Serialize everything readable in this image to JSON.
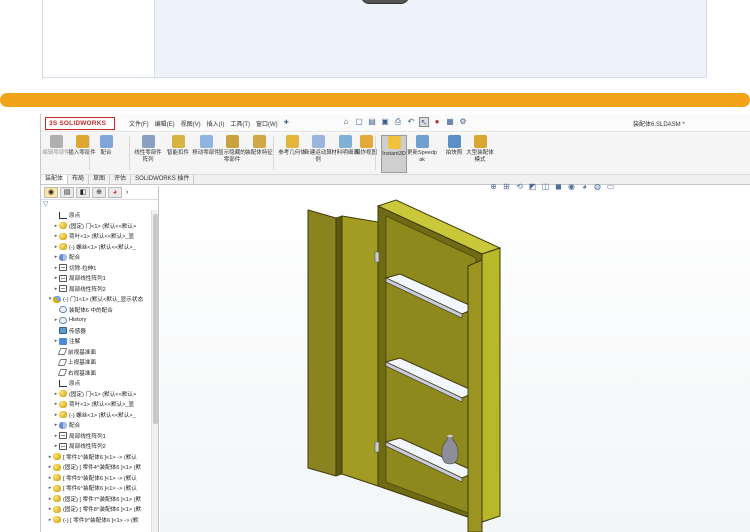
{
  "app": {
    "logo_text": "3S SOLIDWORKS",
    "menus": [
      "文件(F)",
      "编辑(E)",
      "视图(V)",
      "插入(I)",
      "工具(T)",
      "窗口(W)"
    ],
    "document_title": "装配体6.SLDASM *",
    "quick_access_icons": [
      "home-icon",
      "new-icon",
      "open-icon",
      "save-icon",
      "print-icon",
      "undo-icon",
      "select-icon",
      "traffic-light-icon",
      "file-props-icon",
      "options-icon"
    ]
  },
  "ribbon": {
    "buttons": [
      {
        "label": "编辑零部件",
        "icon": "edit-component-icon",
        "dim": true
      },
      {
        "label": "插入零部件",
        "icon": "insert-component-icon",
        "dim": false
      },
      {
        "label": "配合",
        "icon": "mate-icon",
        "dim": false
      },
      {
        "label": "线性零部件阵列",
        "icon": "linear-pattern-icon",
        "dim": false
      },
      {
        "label": "智能扣件",
        "icon": "smart-fastener-icon",
        "dim": false
      },
      {
        "label": "移动零部件",
        "icon": "move-component-icon",
        "dim": false
      },
      {
        "label": "显示隐藏的零部件",
        "icon": "show-hidden-icon",
        "dim": false
      },
      {
        "label": "装配体特征",
        "icon": "assembly-feature-icon",
        "dim": false
      },
      {
        "label": "参考几何体",
        "icon": "reference-geometry-icon",
        "dim": false
      },
      {
        "label": "新建运动算例",
        "icon": "motion-study-icon",
        "dim": false
      },
      {
        "label": "材料明细表",
        "icon": "bom-icon",
        "dim": false
      },
      {
        "label": "爆炸视图",
        "icon": "exploded-view-icon",
        "dim": false
      },
      {
        "label": "Instant3D",
        "icon": "instant3d-icon",
        "dim": false,
        "active": true
      },
      {
        "label": "更新Speedpak",
        "icon": "speedpak-icon",
        "dim": false
      },
      {
        "label": "拍快照",
        "icon": "snapshot-icon",
        "dim": false
      },
      {
        "label": "大型装配体模式",
        "icon": "large-assembly-icon",
        "dim": false
      }
    ]
  },
  "tabs": [
    "装配体",
    "布局",
    "草图",
    "评估",
    "SOLIDWORKS 插件"
  ],
  "tree": {
    "rows": [
      {
        "arrow": "",
        "icon": "origin",
        "label": "原点",
        "indent": 1
      },
      {
        "arrow": "▸",
        "icon": "part",
        "label": "(固定) 门<1> (默认<<默认>",
        "indent": 1
      },
      {
        "arrow": "▸",
        "icon": "part",
        "label": "荷叶<1> (默认<<默认>_显",
        "indent": 1
      },
      {
        "arrow": "▸",
        "icon": "part",
        "label": "(-) 螺丝<1> (默认<<默认>_",
        "indent": 1
      },
      {
        "arrow": "▸",
        "icon": "mate",
        "label": "配合",
        "indent": 1
      },
      {
        "arrow": "▸",
        "icon": "feat",
        "label": "切除-拉伸1",
        "indent": 1
      },
      {
        "arrow": "▸",
        "icon": "feat",
        "label": "局部线性阵列1",
        "indent": 1
      },
      {
        "arrow": "▸",
        "icon": "feat",
        "label": "局部线性阵列2",
        "indent": 1
      },
      {
        "arrow": "▾",
        "icon": "sub",
        "label": "(-) 门1<1> (默认<默认_显示状态",
        "indent": 0
      },
      {
        "arrow": "",
        "icon": "hist",
        "label": "装配体6 中的配合",
        "indent": 1
      },
      {
        "arrow": "▸",
        "icon": "hist",
        "label": "History",
        "indent": 1
      },
      {
        "arrow": "",
        "icon": "sensor",
        "label": "传感器",
        "indent": 1
      },
      {
        "arrow": "▸",
        "icon": "note",
        "label": "注解",
        "indent": 1
      },
      {
        "arrow": "",
        "icon": "plane",
        "label": "前视基准面",
        "indent": 1
      },
      {
        "arrow": "",
        "icon": "plane",
        "label": "上视基准面",
        "indent": 1
      },
      {
        "arrow": "",
        "icon": "plane",
        "label": "右视基准面",
        "indent": 1
      },
      {
        "arrow": "",
        "icon": "origin",
        "label": "原点",
        "indent": 1
      },
      {
        "arrow": "▸",
        "icon": "part",
        "label": "(固定) 门<1> (默认<<默认>",
        "indent": 1
      },
      {
        "arrow": "▸",
        "icon": "part",
        "label": "荷叶<1> (默认<<默认>_显",
        "indent": 1
      },
      {
        "arrow": "▸",
        "icon": "part",
        "label": "(-) 螺丝<1> (默认<<默认>_",
        "indent": 1
      },
      {
        "arrow": "▸",
        "icon": "mate",
        "label": "配合",
        "indent": 1
      },
      {
        "arrow": "▸",
        "icon": "feat",
        "label": "局部线性阵列1",
        "indent": 1
      },
      {
        "arrow": "▸",
        "icon": "feat",
        "label": "局部线性阵列2",
        "indent": 1
      },
      {
        "arrow": "▸",
        "icon": "part",
        "label": "[ 零件1^装配体6 ]<1> -> (默认",
        "indent": 0
      },
      {
        "arrow": "▸",
        "icon": "part",
        "label": "(固定) [ 零件4^装配体6 ]<1> (默",
        "indent": 0
      },
      {
        "arrow": "▸",
        "icon": "part",
        "label": "[ 零件5^装配体6 ]<1> -> (默认",
        "indent": 0
      },
      {
        "arrow": "▸",
        "icon": "part",
        "label": "[ 零件6^装配体6 ]<1> -> (默认",
        "indent": 0
      },
      {
        "arrow": "▸",
        "icon": "part",
        "label": "(固定) [ 零件7^装配体6 ]<1> (默",
        "indent": 0
      },
      {
        "arrow": "▸",
        "icon": "part",
        "label": "(固定) [ 零件8^装配体6 ]<1> (默",
        "indent": 0
      },
      {
        "arrow": "▸",
        "icon": "part",
        "label": "(-) [ 零件9^装配体6 ]<1> -> (默",
        "indent": 0
      }
    ]
  },
  "colors": {
    "orange_bar": "#f3a318",
    "cabinet_body": "#b7b82a",
    "cabinet_dark": "#6f6a14",
    "door": "#8a8420",
    "shelf": "#f4f6ff"
  }
}
